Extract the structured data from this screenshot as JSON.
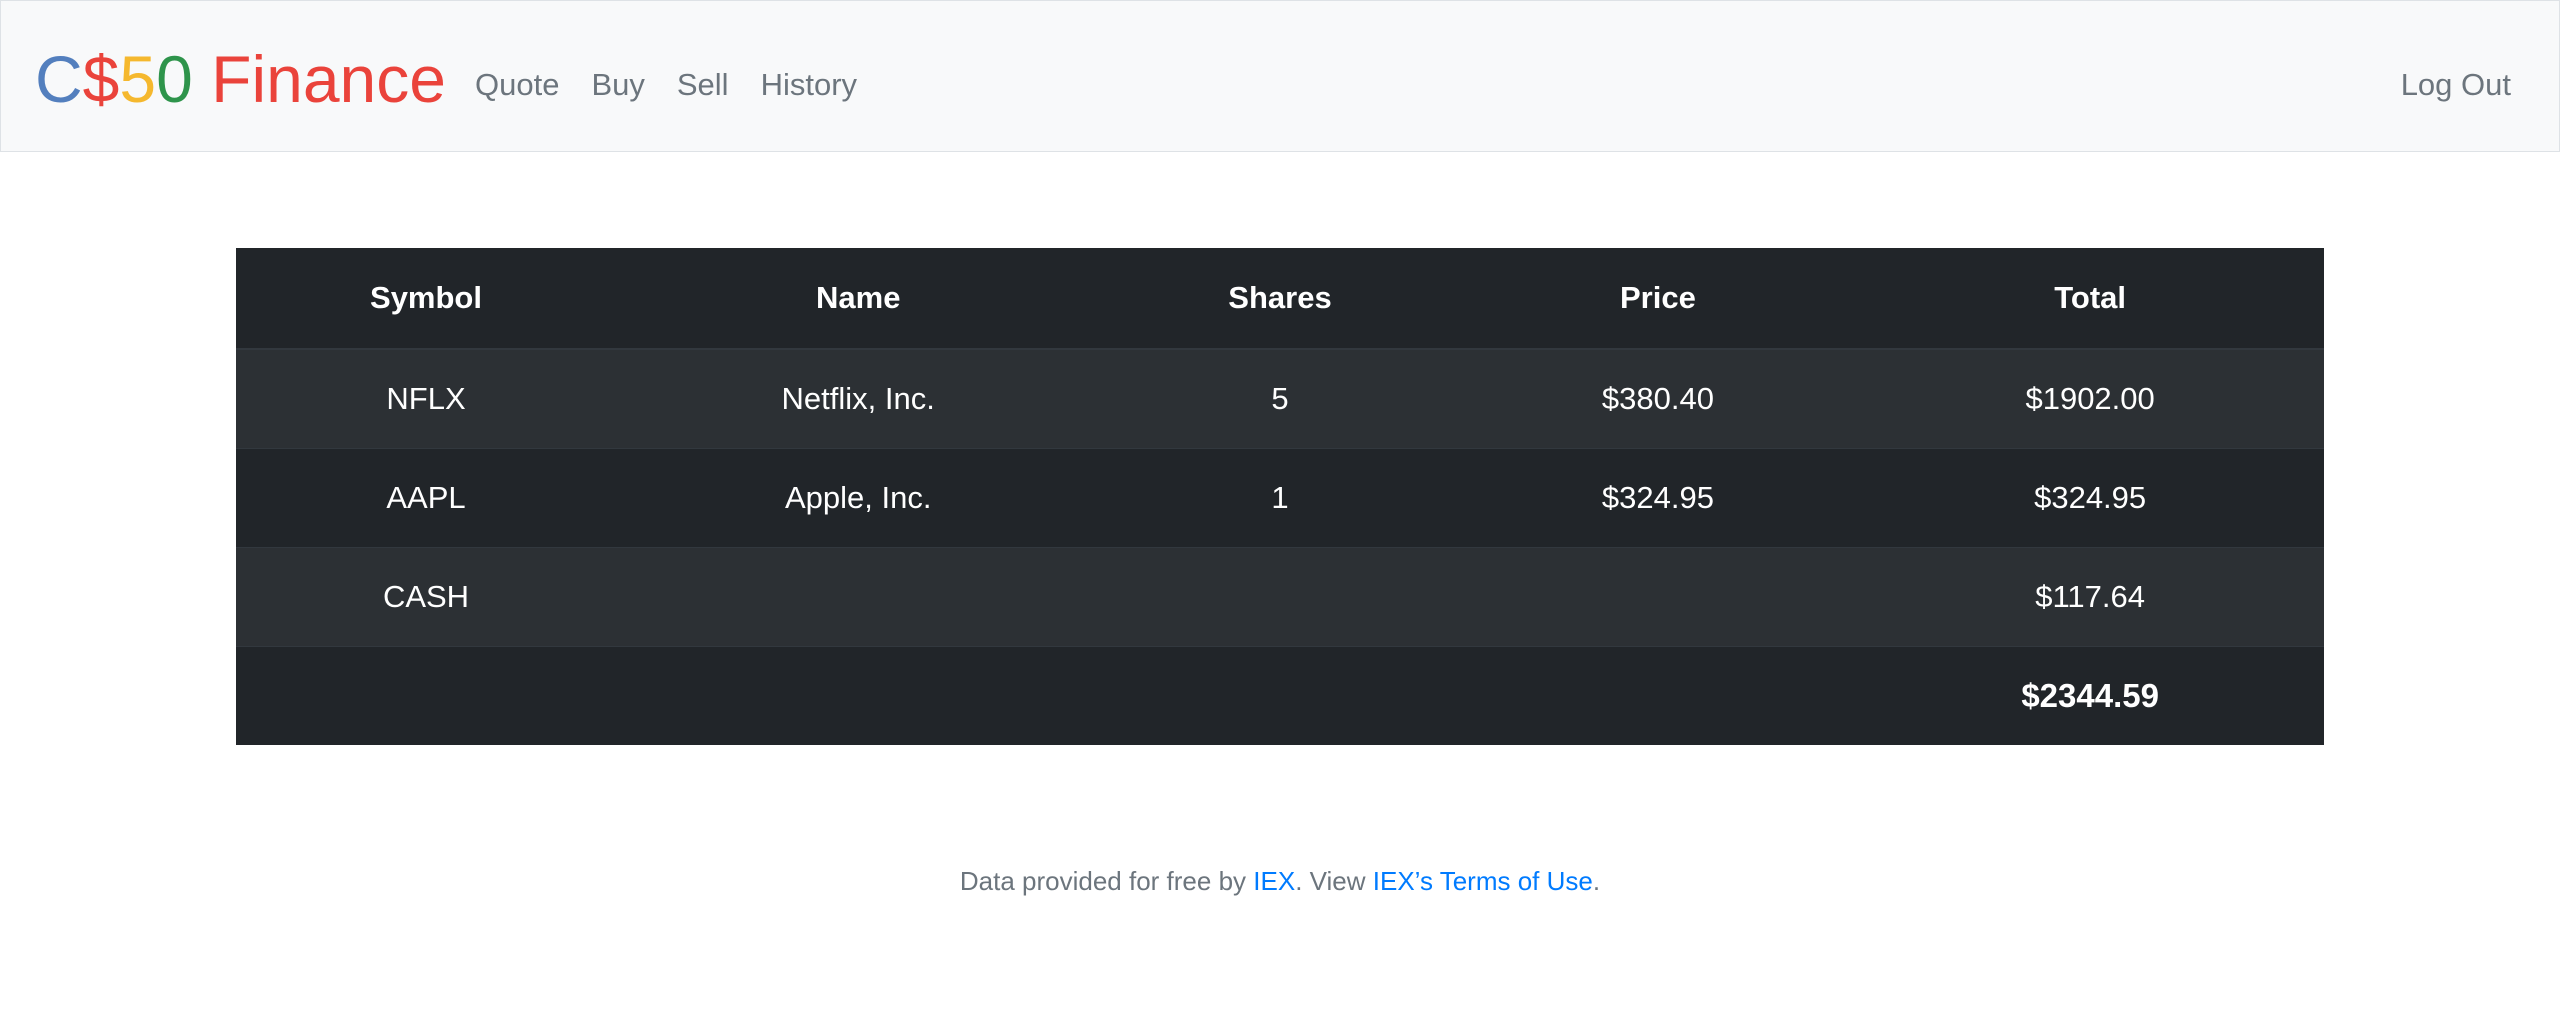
{
  "brand": {
    "parts": [
      {
        "text": "C",
        "color": "#537fbe"
      },
      {
        "text": "$",
        "color": "#ea433b"
      },
      {
        "text": "5",
        "color": "#f5b82e"
      },
      {
        "text": "0",
        "color": "#2e944b"
      },
      {
        "text": " Finance",
        "color": "#ea433b"
      }
    ]
  },
  "nav": {
    "links": [
      "Quote",
      "Buy",
      "Sell",
      "History"
    ],
    "logout": "Log Out"
  },
  "table": {
    "headers": [
      "Symbol",
      "Name",
      "Shares",
      "Price",
      "Total"
    ],
    "rows": [
      {
        "symbol": "NFLX",
        "name": "Netflix, Inc.",
        "shares": "5",
        "price": "$380.40",
        "total": "$1902.00"
      },
      {
        "symbol": "AAPL",
        "name": "Apple, Inc.",
        "shares": "1",
        "price": "$324.95",
        "total": "$324.95"
      },
      {
        "symbol": "CASH",
        "name": "",
        "shares": "",
        "price": "",
        "total": "$117.64"
      }
    ],
    "grand_total": "$2344.59"
  },
  "footer": {
    "prefix": "Data provided for free by ",
    "iex_link": "IEX",
    "middle": ". View ",
    "terms_link": "IEX’s Terms of Use",
    "suffix": "."
  }
}
